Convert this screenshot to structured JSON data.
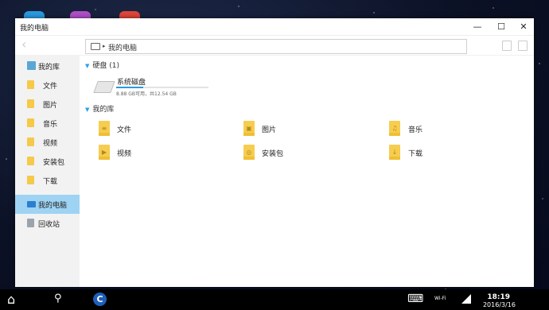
{
  "window": {
    "title": "我的电脑",
    "minimize": "—",
    "maximize": "☐",
    "close": "✕"
  },
  "toolbar": {
    "back": "‹",
    "path_arrow": "▸",
    "path": "我的电脑"
  },
  "sidebar": {
    "items": [
      {
        "label": "我的库",
        "icon": "library-icon"
      },
      {
        "label": "文件",
        "icon": "folder-documents-icon"
      },
      {
        "label": "图片",
        "icon": "folder-pictures-icon"
      },
      {
        "label": "音乐",
        "icon": "folder-music-icon"
      },
      {
        "label": "视频",
        "icon": "folder-videos-icon"
      },
      {
        "label": "安装包",
        "icon": "folder-packages-icon"
      },
      {
        "label": "下载",
        "icon": "folder-downloads-icon"
      },
      {
        "label": "我的电脑",
        "icon": "computer-icon",
        "active": true
      },
      {
        "label": "回收站",
        "icon": "recycle-bin-icon"
      }
    ]
  },
  "content": {
    "disks_header": "硬盘 (1)",
    "disk": {
      "name": "系统磁盘",
      "free_text": "8.88 GB可用，共12.54 GB",
      "free_gb": 8.88,
      "total_gb": 12.54
    },
    "library_header": "我的库",
    "library": [
      {
        "label": "文件",
        "glyph": "≡"
      },
      {
        "label": "图片",
        "glyph": "▣"
      },
      {
        "label": "音乐",
        "glyph": "♫"
      },
      {
        "label": "视频",
        "glyph": "▶"
      },
      {
        "label": "安装包",
        "glyph": "◎"
      },
      {
        "label": "下载",
        "glyph": "↓"
      }
    ]
  },
  "taskbar": {
    "home": "⌂",
    "search": "⚲",
    "app": "C",
    "keyboard": "⌨",
    "wifi": "Wi-Fi",
    "time": "18:19",
    "date": "2016/3/16"
  },
  "colors": {
    "accent": "#2aa0e5",
    "folder": "#f7cd4f",
    "sidebar_active": "#9ed3f3"
  }
}
